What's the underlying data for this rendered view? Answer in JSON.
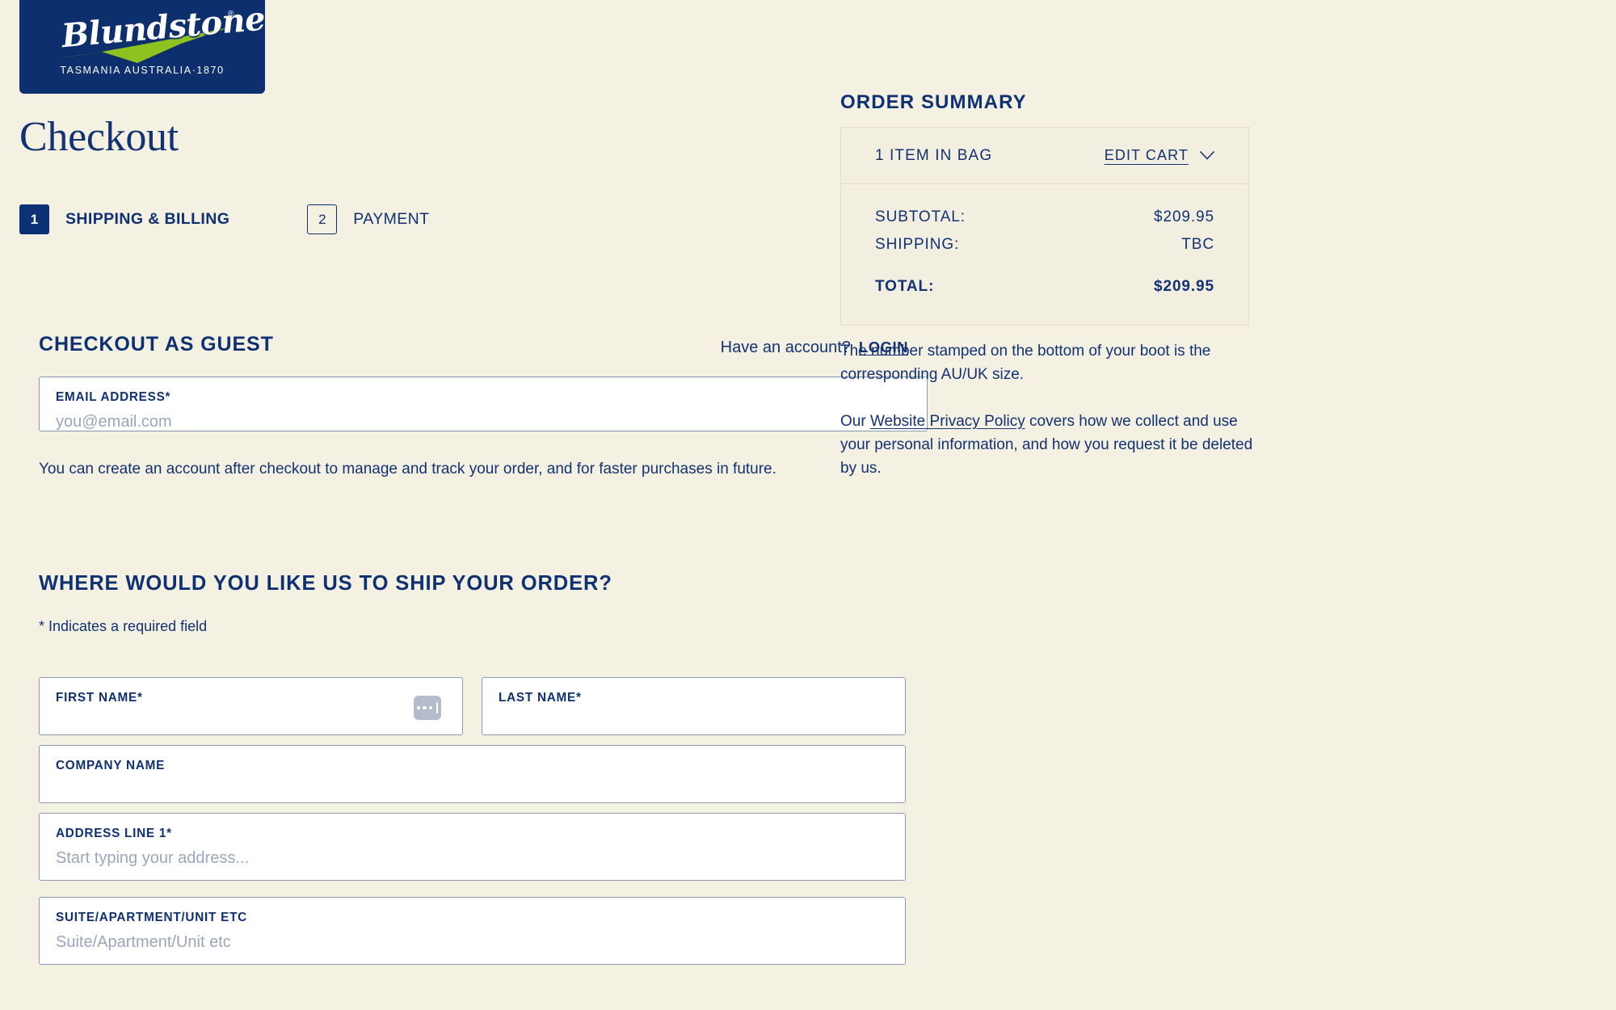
{
  "brand": {
    "logo_word": "Blundstone",
    "logo_reg": "®",
    "logo_tagline": "TASMANIA AUSTRALIA·1870",
    "navy": "#0d2f6e",
    "green": "#8dc21f",
    "cream": "#f4f1e3"
  },
  "page": {
    "title": "Checkout"
  },
  "steps": [
    {
      "num": "1",
      "label": "SHIPPING & BILLING"
    },
    {
      "num": "2",
      "label": "PAYMENT"
    }
  ],
  "guest": {
    "heading": "CHECKOUT AS GUEST",
    "have_account_text": "Have an account?",
    "login_label": "LOGIN",
    "email_label": "EMAIL ADDRESS*",
    "email_placeholder": "you@email.com",
    "email_value": "",
    "helper": "You can create an account after checkout to manage and track your order, and for faster purchases in future."
  },
  "shipping": {
    "heading": "WHERE WOULD YOU LIKE US TO SHIP YOUR ORDER?",
    "required_note": "* Indicates a required field",
    "fields": [
      {
        "label": "FIRST NAME*",
        "placeholder": "",
        "value": ""
      },
      {
        "label": "LAST NAME*",
        "placeholder": "",
        "value": ""
      },
      {
        "label": "COMPANY NAME",
        "placeholder": "",
        "value": ""
      },
      {
        "label": "ADDRESS LINE 1*",
        "placeholder": "Start typing your address...",
        "value": ""
      },
      {
        "label": "SUITE/APARTMENT/UNIT ETC",
        "placeholder": "Suite/Apartment/Unit etc",
        "value": ""
      }
    ],
    "autofill_icon": "autofill-icon"
  },
  "summary": {
    "heading": "ORDER SUMMARY",
    "bag_count": "1  ITEM IN BAG",
    "edit_cart_label": "EDIT CART",
    "chevron_icon": "chevron-down-icon",
    "rows": [
      {
        "label": "SUBTOTAL:",
        "value": "$209.95"
      },
      {
        "label": "SHIPPING:",
        "value": "TBC"
      }
    ],
    "total": {
      "label": "TOTAL:",
      "value": "$209.95"
    }
  },
  "side_info": {
    "para_1": "The number stamped on the bottom of your boot is the corresponding AU/UK size.",
    "para_2_before": "Our ",
    "privacy_link": "Website Privacy Policy",
    "para_2_after": " covers how we collect and use your personal information, and how you request it be deleted by us."
  }
}
